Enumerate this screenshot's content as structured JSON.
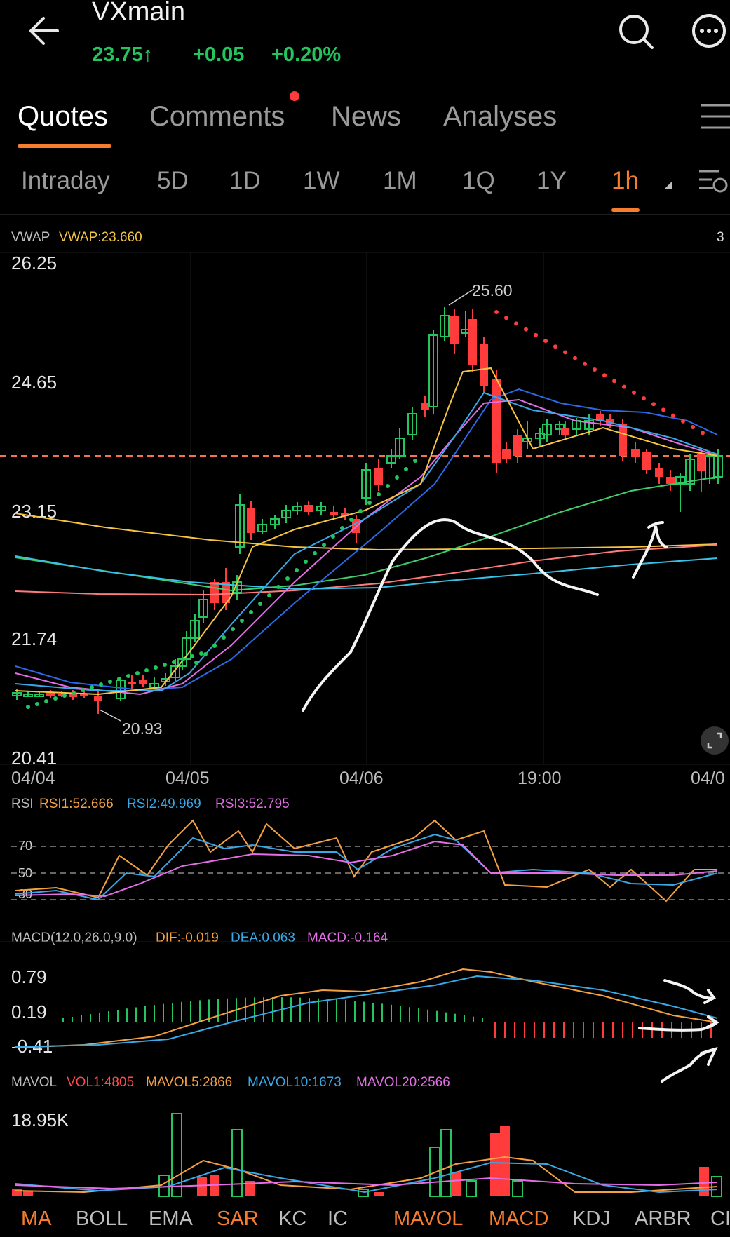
{
  "header": {
    "back_icon": "arrow-left-icon",
    "symbol": "VXmain",
    "price": "23.75",
    "price_arrow": "↑",
    "change": "+0.05",
    "change_pct": "+0.20%",
    "search_icon": "search-icon",
    "chat_icon": "chat-bubble-icon",
    "colors": {
      "up": "#22c55e",
      "down": "#ff3b3b",
      "accent": "#f57d2d"
    }
  },
  "tabs": [
    {
      "label": "Quotes",
      "active": true
    },
    {
      "label": "Comments",
      "badge_dot": true
    },
    {
      "label": "News"
    },
    {
      "label": "Analyses"
    }
  ],
  "periods": [
    {
      "label": "Intraday"
    },
    {
      "label": "5D"
    },
    {
      "label": "1D"
    },
    {
      "label": "1W"
    },
    {
      "label": "1M"
    },
    {
      "label": "1Q"
    },
    {
      "label": "1Y"
    },
    {
      "label": "1h",
      "active": true
    }
  ],
  "main_chart": {
    "indicator_name": "VWAP",
    "vwap_text": "VWAP:23.660",
    "right_corner": "3",
    "y_ticks": [
      "26.25",
      "24.65",
      "23.15",
      "21.74",
      "20.41"
    ],
    "x_ticks": [
      "04/04",
      "04/05",
      "04/06",
      "19:00",
      "04/0"
    ],
    "high_label": "25.60",
    "low_label": "20.93"
  },
  "rsi": {
    "name": "RSI",
    "rsi1": "RSI1:52.666",
    "rsi2": "RSI2:49.969",
    "rsi3": "RSI3:52.795",
    "levels": [
      "70",
      "50",
      "30"
    ]
  },
  "macd": {
    "name": "MACD(12.0,26.0,9.0)",
    "dif": "DIF:-0.019",
    "dea": "DEA:0.063",
    "macd": "MACD:-0.164",
    "y_ticks": [
      "0.79",
      "0.19",
      "-0.41"
    ]
  },
  "mavol": {
    "name": "MAVOL",
    "vol1": "VOL1:4805",
    "mavol5": "MAVOL5:2866",
    "mavol10": "MAVOL10:1673",
    "mavol20": "MAVOL20:2566",
    "y_tick": "18.95K"
  },
  "indicator_bar": [
    {
      "label": "MA",
      "on": true
    },
    {
      "label": "BOLL"
    },
    {
      "label": "EMA"
    },
    {
      "label": "SAR",
      "on": true
    },
    {
      "label": "KC"
    },
    {
      "label": "IC"
    },
    {
      "label": "MAVOL",
      "on": true
    },
    {
      "label": "MACD",
      "on": true
    },
    {
      "label": "KDJ"
    },
    {
      "label": "ARBR"
    },
    {
      "label": "CI"
    }
  ]
}
